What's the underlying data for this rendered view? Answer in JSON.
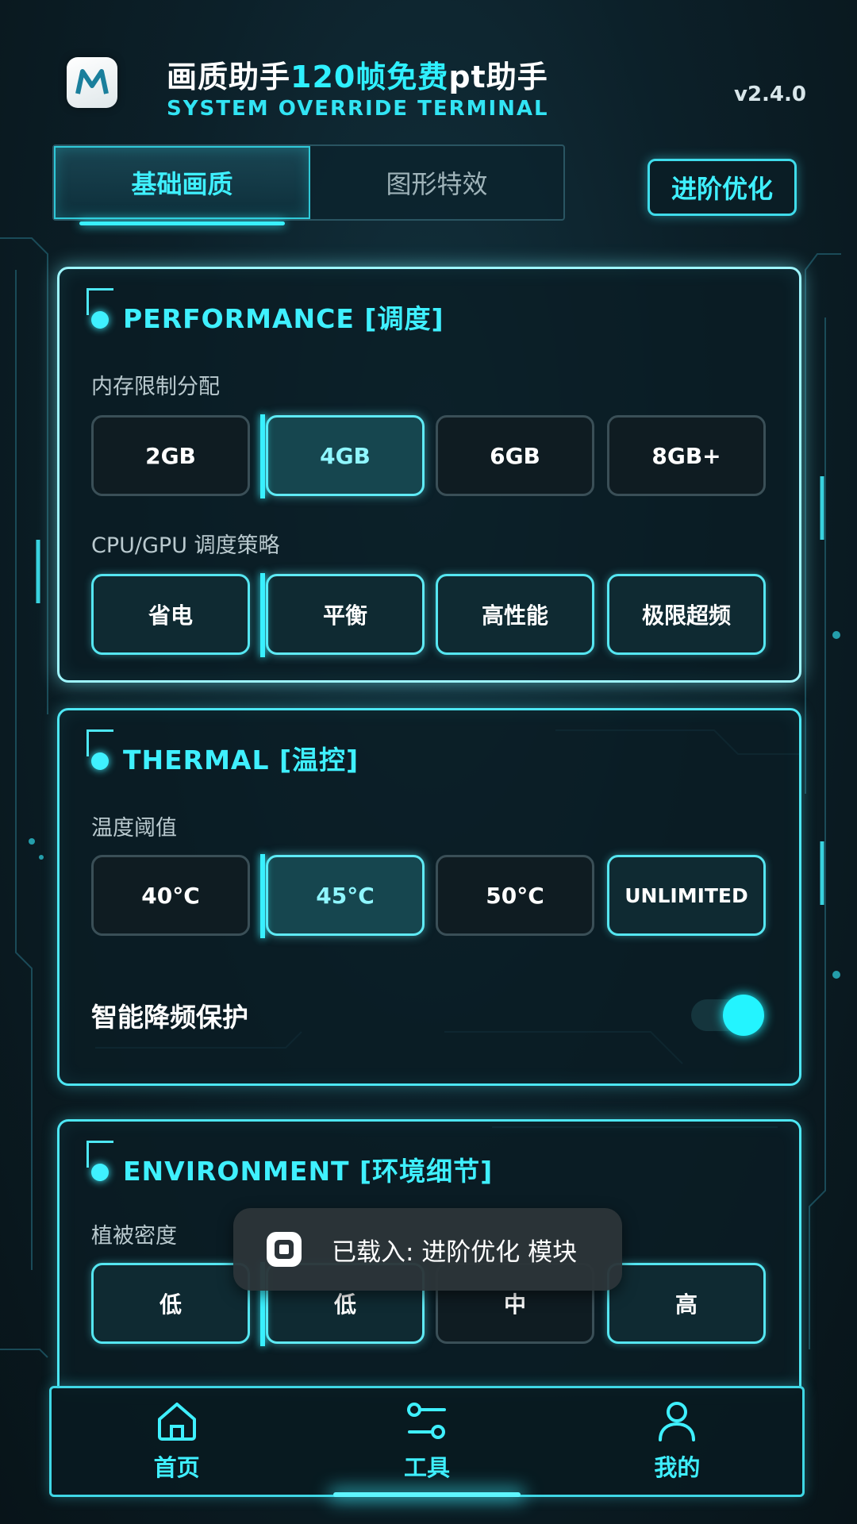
{
  "header": {
    "title_prefix": "画质助手",
    "title_highlight": "120帧免费",
    "title_suffix": "pt助手",
    "subtitle": "SYSTEM OVERRIDE TERMINAL",
    "version": "v2.4.0"
  },
  "tabs": [
    {
      "label": "基础画质",
      "active": true
    },
    {
      "label": "图形特效",
      "active": false
    }
  ],
  "advanced_button": "进阶优化",
  "performance": {
    "title": "PERFORMANCE [调度]",
    "memory_label": "内存限制分配",
    "memory_options": [
      "2GB",
      "4GB",
      "6GB",
      "8GB+"
    ],
    "memory_selected": "4GB",
    "cpu_label": "CPU/GPU 调度策略",
    "cpu_options": [
      "省电",
      "平衡",
      "高性能",
      "极限超频"
    ],
    "cpu_selected": "平衡"
  },
  "thermal": {
    "title": "THERMAL [温控]",
    "temp_label": "温度阈值",
    "temp_options": [
      "40°C",
      "45°C",
      "50°C",
      "UNLIMITED"
    ],
    "temp_selected": "45°C",
    "toggle_label": "智能降频保护",
    "toggle_on": true
  },
  "environment": {
    "title": "ENVIRONMENT [环境细节]",
    "veg_label": "植被密度",
    "veg_options": [
      "低",
      "低",
      "中",
      "高"
    ]
  },
  "toast": {
    "text": "已载入: 进阶优化 模块"
  },
  "bottom_nav": [
    {
      "label": "首页",
      "icon": "home-icon"
    },
    {
      "label": "工具",
      "icon": "tools-icon",
      "active": true
    },
    {
      "label": "我的",
      "icon": "user-icon"
    }
  ],
  "colors": {
    "accent": "#3ff0ff",
    "background": "#0b1c25",
    "panel_border": "#4de7f4"
  }
}
